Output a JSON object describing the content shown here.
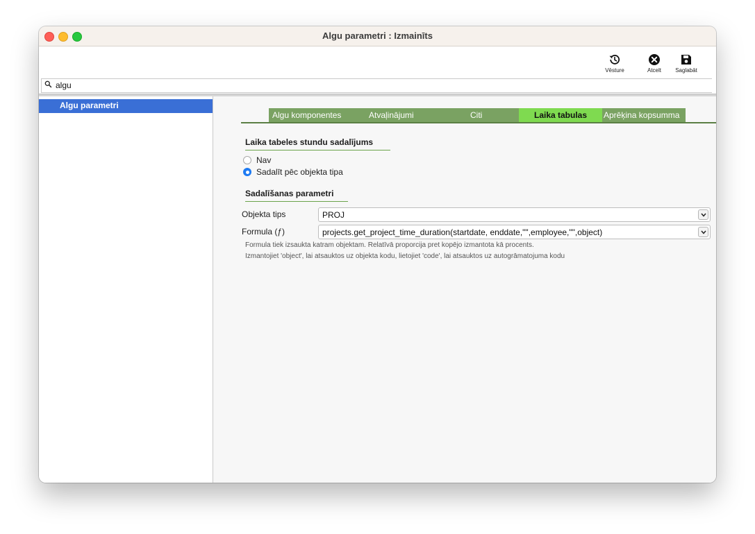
{
  "window": {
    "title": "Algu parametri : Izmainīts"
  },
  "toolbar": {
    "history_label": "Vēsture",
    "cancel_label": "Atcelt",
    "save_label": "Saglabāt"
  },
  "search": {
    "value": "algu"
  },
  "sidebar": {
    "items": [
      {
        "label": "Algu parametri"
      }
    ]
  },
  "tabs": [
    {
      "label": "Algu komponentes"
    },
    {
      "label": "Atvaļinājumi"
    },
    {
      "label": "Citi"
    },
    {
      "label": "Laika tabulas"
    },
    {
      "label": "Aprēķina kopsumma"
    }
  ],
  "section1": {
    "title": "Laika tabeles stundu sadalījums",
    "options": [
      {
        "label": "Nav",
        "checked": false
      },
      {
        "label": "Sadalīt pēc objekta tipa",
        "checked": true
      }
    ]
  },
  "section2": {
    "title": "Sadalīšanas parametri",
    "object_type_label": "Objekta tips",
    "object_type_value": "PROJ",
    "formula_label": "Formula (ƒ)",
    "formula_value": "projects.get_project_time_duration(startdate, enddate,\"\",employee,\"\",object)",
    "hint1": "Formula tiek izsaukta katram objektam. Relatīvā proporcija pret kopējo izmantota kā procents.",
    "hint2": "Izmantojiet 'object', lai atsauktos uz objekta kodu, lietojiet 'code', lai atsauktos uz autogrāmatojuma kodu"
  }
}
